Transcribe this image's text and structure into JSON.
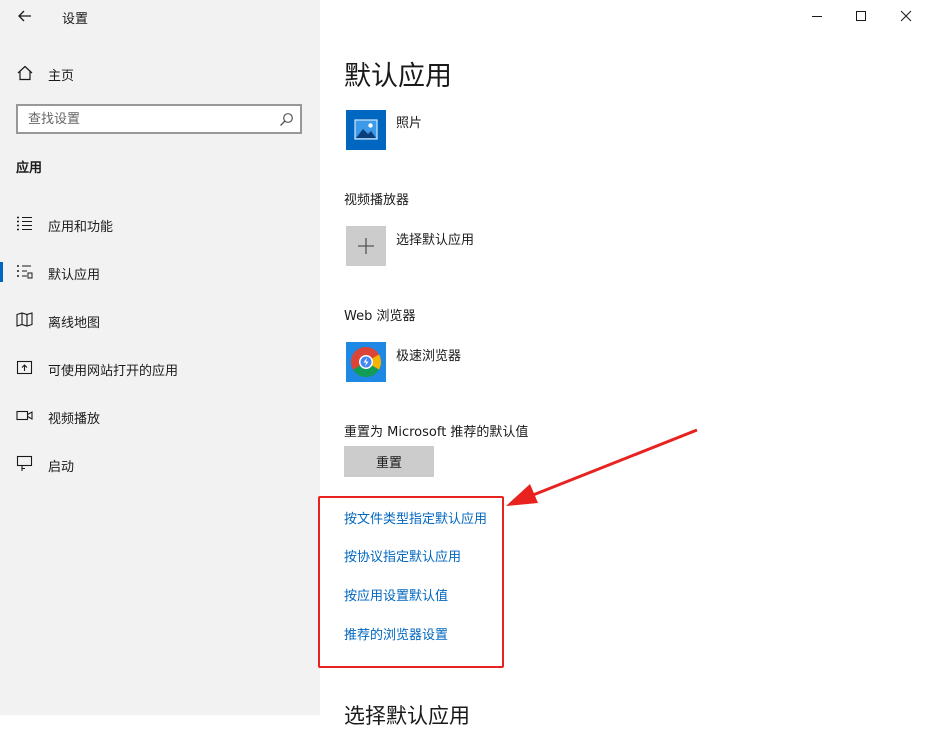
{
  "sidebar": {
    "app_title": "设置",
    "home_label": "主页",
    "search": {
      "placeholder": "查找设置"
    },
    "section_title": "应用",
    "items": [
      {
        "label": "应用和功能",
        "icon": "list-icon"
      },
      {
        "label": "默认应用",
        "icon": "default-apps-icon",
        "active": true
      },
      {
        "label": "离线地图",
        "icon": "map-icon"
      },
      {
        "label": "可使用网站打开的应用",
        "icon": "open-website-icon"
      },
      {
        "label": "视频播放",
        "icon": "video-icon"
      },
      {
        "label": "启动",
        "icon": "startup-icon"
      }
    ]
  },
  "main": {
    "title": "默认应用",
    "photos": {
      "app_label": "照片",
      "icon": "photos-icon"
    },
    "video": {
      "category": "视频播放器",
      "app_label": "选择默认应用",
      "icon": "plus-icon"
    },
    "web": {
      "category": "Web 浏览器",
      "app_label": "极速浏览器",
      "icon": "browser-icon"
    },
    "reset": {
      "label": "重置为 Microsoft 推荐的默认值",
      "button": "重置"
    },
    "links": [
      "按文件类型指定默认应用",
      "按协议指定默认应用",
      "按应用设置默认值",
      "推荐的浏览器设置"
    ],
    "next_heading": "选择默认应用"
  },
  "annotation": {
    "color": "#e8231f"
  },
  "colors": {
    "accent": "#0067c0",
    "sidebar_bg": "#f2f2f2",
    "button_bg": "#cccccc"
  }
}
